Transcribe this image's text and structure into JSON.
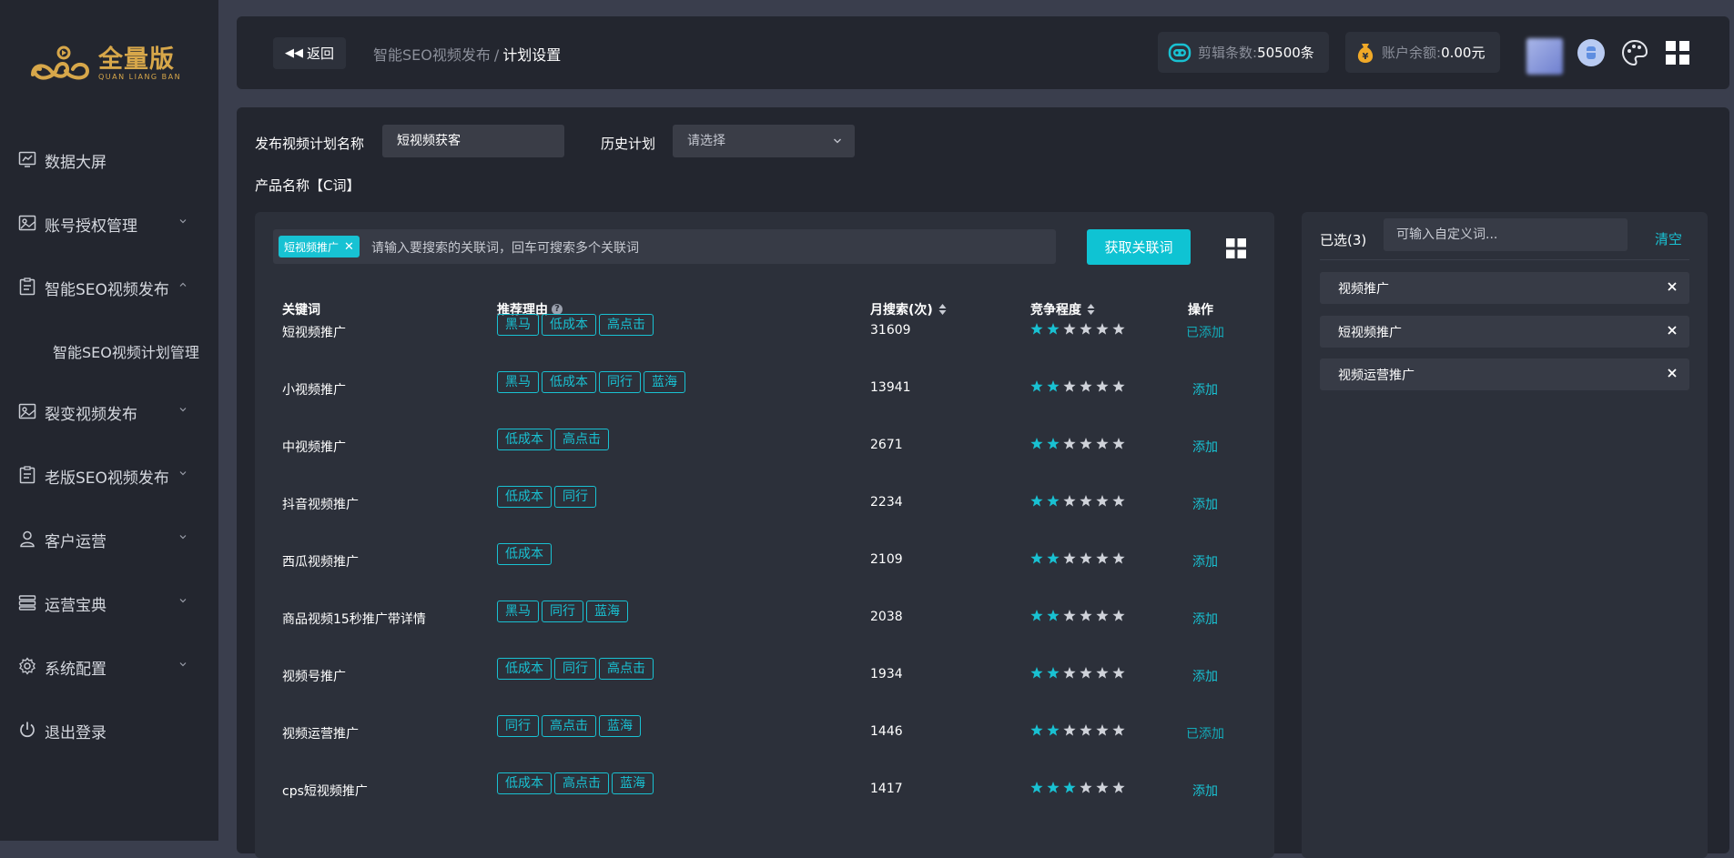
{
  "logo": {
    "cn": "全量版",
    "en": "QUAN LIANG BAN"
  },
  "nav": {
    "items": [
      {
        "label": "数据大屏",
        "icon": "monitor-chart-icon",
        "chevron": ""
      },
      {
        "label": "账号授权管理",
        "icon": "image-card-icon",
        "chevron": "down"
      },
      {
        "label": "智能SEO视频发布",
        "icon": "clipboard-icon",
        "chevron": "up"
      },
      {
        "label": "裂变视频发布",
        "icon": "image-card-icon",
        "chevron": "down"
      },
      {
        "label": "老版SEO视频发布",
        "icon": "clipboard-icon",
        "chevron": "down"
      },
      {
        "label": "客户运营",
        "icon": "user-icon",
        "chevron": "down"
      },
      {
        "label": "运营宝典",
        "icon": "layers-icon",
        "chevron": "down"
      },
      {
        "label": "系统配置",
        "icon": "settings-gear-icon",
        "chevron": "down"
      },
      {
        "label": "退出登录",
        "icon": "power-icon",
        "chevron": ""
      }
    ],
    "sub_item": "智能SEO视频计划管理"
  },
  "header": {
    "back_label": "返回",
    "breadcrumb": [
      "智能SEO视频发布",
      "计划设置"
    ],
    "breadcrumb_sep": "/",
    "clips_label": "剪辑条数:",
    "clips_value": "50500条",
    "balance_label": "账户余额:",
    "balance_value": "0.00元"
  },
  "form": {
    "plan_name_label": "发布视频计划名称",
    "plan_name_value": "短视频获客",
    "history_label": "历史计划",
    "history_placeholder": "请选择",
    "product_label": "产品名称【C词】"
  },
  "search": {
    "chip": "短视频推广",
    "placeholder": "请输入要搜索的关联词，回车可搜索多个关联词",
    "button": "获取关联词"
  },
  "table": {
    "headers": {
      "keyword": "关键词",
      "reason": "推荐理由",
      "monthly": "月搜索(次)",
      "competition": "竞争程度",
      "action": "操作"
    },
    "rows": [
      {
        "keyword": "短视频推广",
        "tags": [
          "黑马",
          "低成本",
          "高点击"
        ],
        "monthly": "31609",
        "stars": 2,
        "action": "已添加",
        "added": true
      },
      {
        "keyword": "小视频推广",
        "tags": [
          "黑马",
          "低成本",
          "同行",
          "蓝海"
        ],
        "monthly": "13941",
        "stars": 2,
        "action": "添加",
        "added": false
      },
      {
        "keyword": "中视频推广",
        "tags": [
          "低成本",
          "高点击"
        ],
        "monthly": "2671",
        "stars": 2,
        "action": "添加",
        "added": false
      },
      {
        "keyword": "抖音视频推广",
        "tags": [
          "低成本",
          "同行"
        ],
        "monthly": "2234",
        "stars": 2,
        "action": "添加",
        "added": false
      },
      {
        "keyword": "西瓜视频推广",
        "tags": [
          "低成本"
        ],
        "monthly": "2109",
        "stars": 2,
        "action": "添加",
        "added": false
      },
      {
        "keyword": "商品视频15秒推广带详情",
        "tags": [
          "黑马",
          "同行",
          "蓝海"
        ],
        "monthly": "2038",
        "stars": 2,
        "action": "添加",
        "added": false
      },
      {
        "keyword": "视频号推广",
        "tags": [
          "低成本",
          "同行",
          "高点击"
        ],
        "monthly": "1934",
        "stars": 2,
        "action": "添加",
        "added": false
      },
      {
        "keyword": "视频运营推广",
        "tags": [
          "同行",
          "高点击",
          "蓝海"
        ],
        "monthly": "1446",
        "stars": 2,
        "action": "已添加",
        "added": true
      },
      {
        "keyword": "cps短视频推广",
        "tags": [
          "低成本",
          "高点击",
          "蓝海"
        ],
        "monthly": "1417",
        "stars": 3,
        "action": "添加",
        "added": false
      }
    ],
    "star_total": 6
  },
  "selected": {
    "count_label": "已选(3)",
    "input_placeholder": "可输入自定义词...",
    "clear_label": "清空",
    "items": [
      "视频推广",
      "短视频推广",
      "视频运营推广"
    ]
  },
  "colors": {
    "accent": "#19c1d2",
    "sidebar_bg": "#23262f",
    "panel_bg": "#2c303a",
    "page_bg": "#3a3e4d",
    "star_inactive": "#cfd2d9",
    "logo_gold": "#d7a74a"
  }
}
